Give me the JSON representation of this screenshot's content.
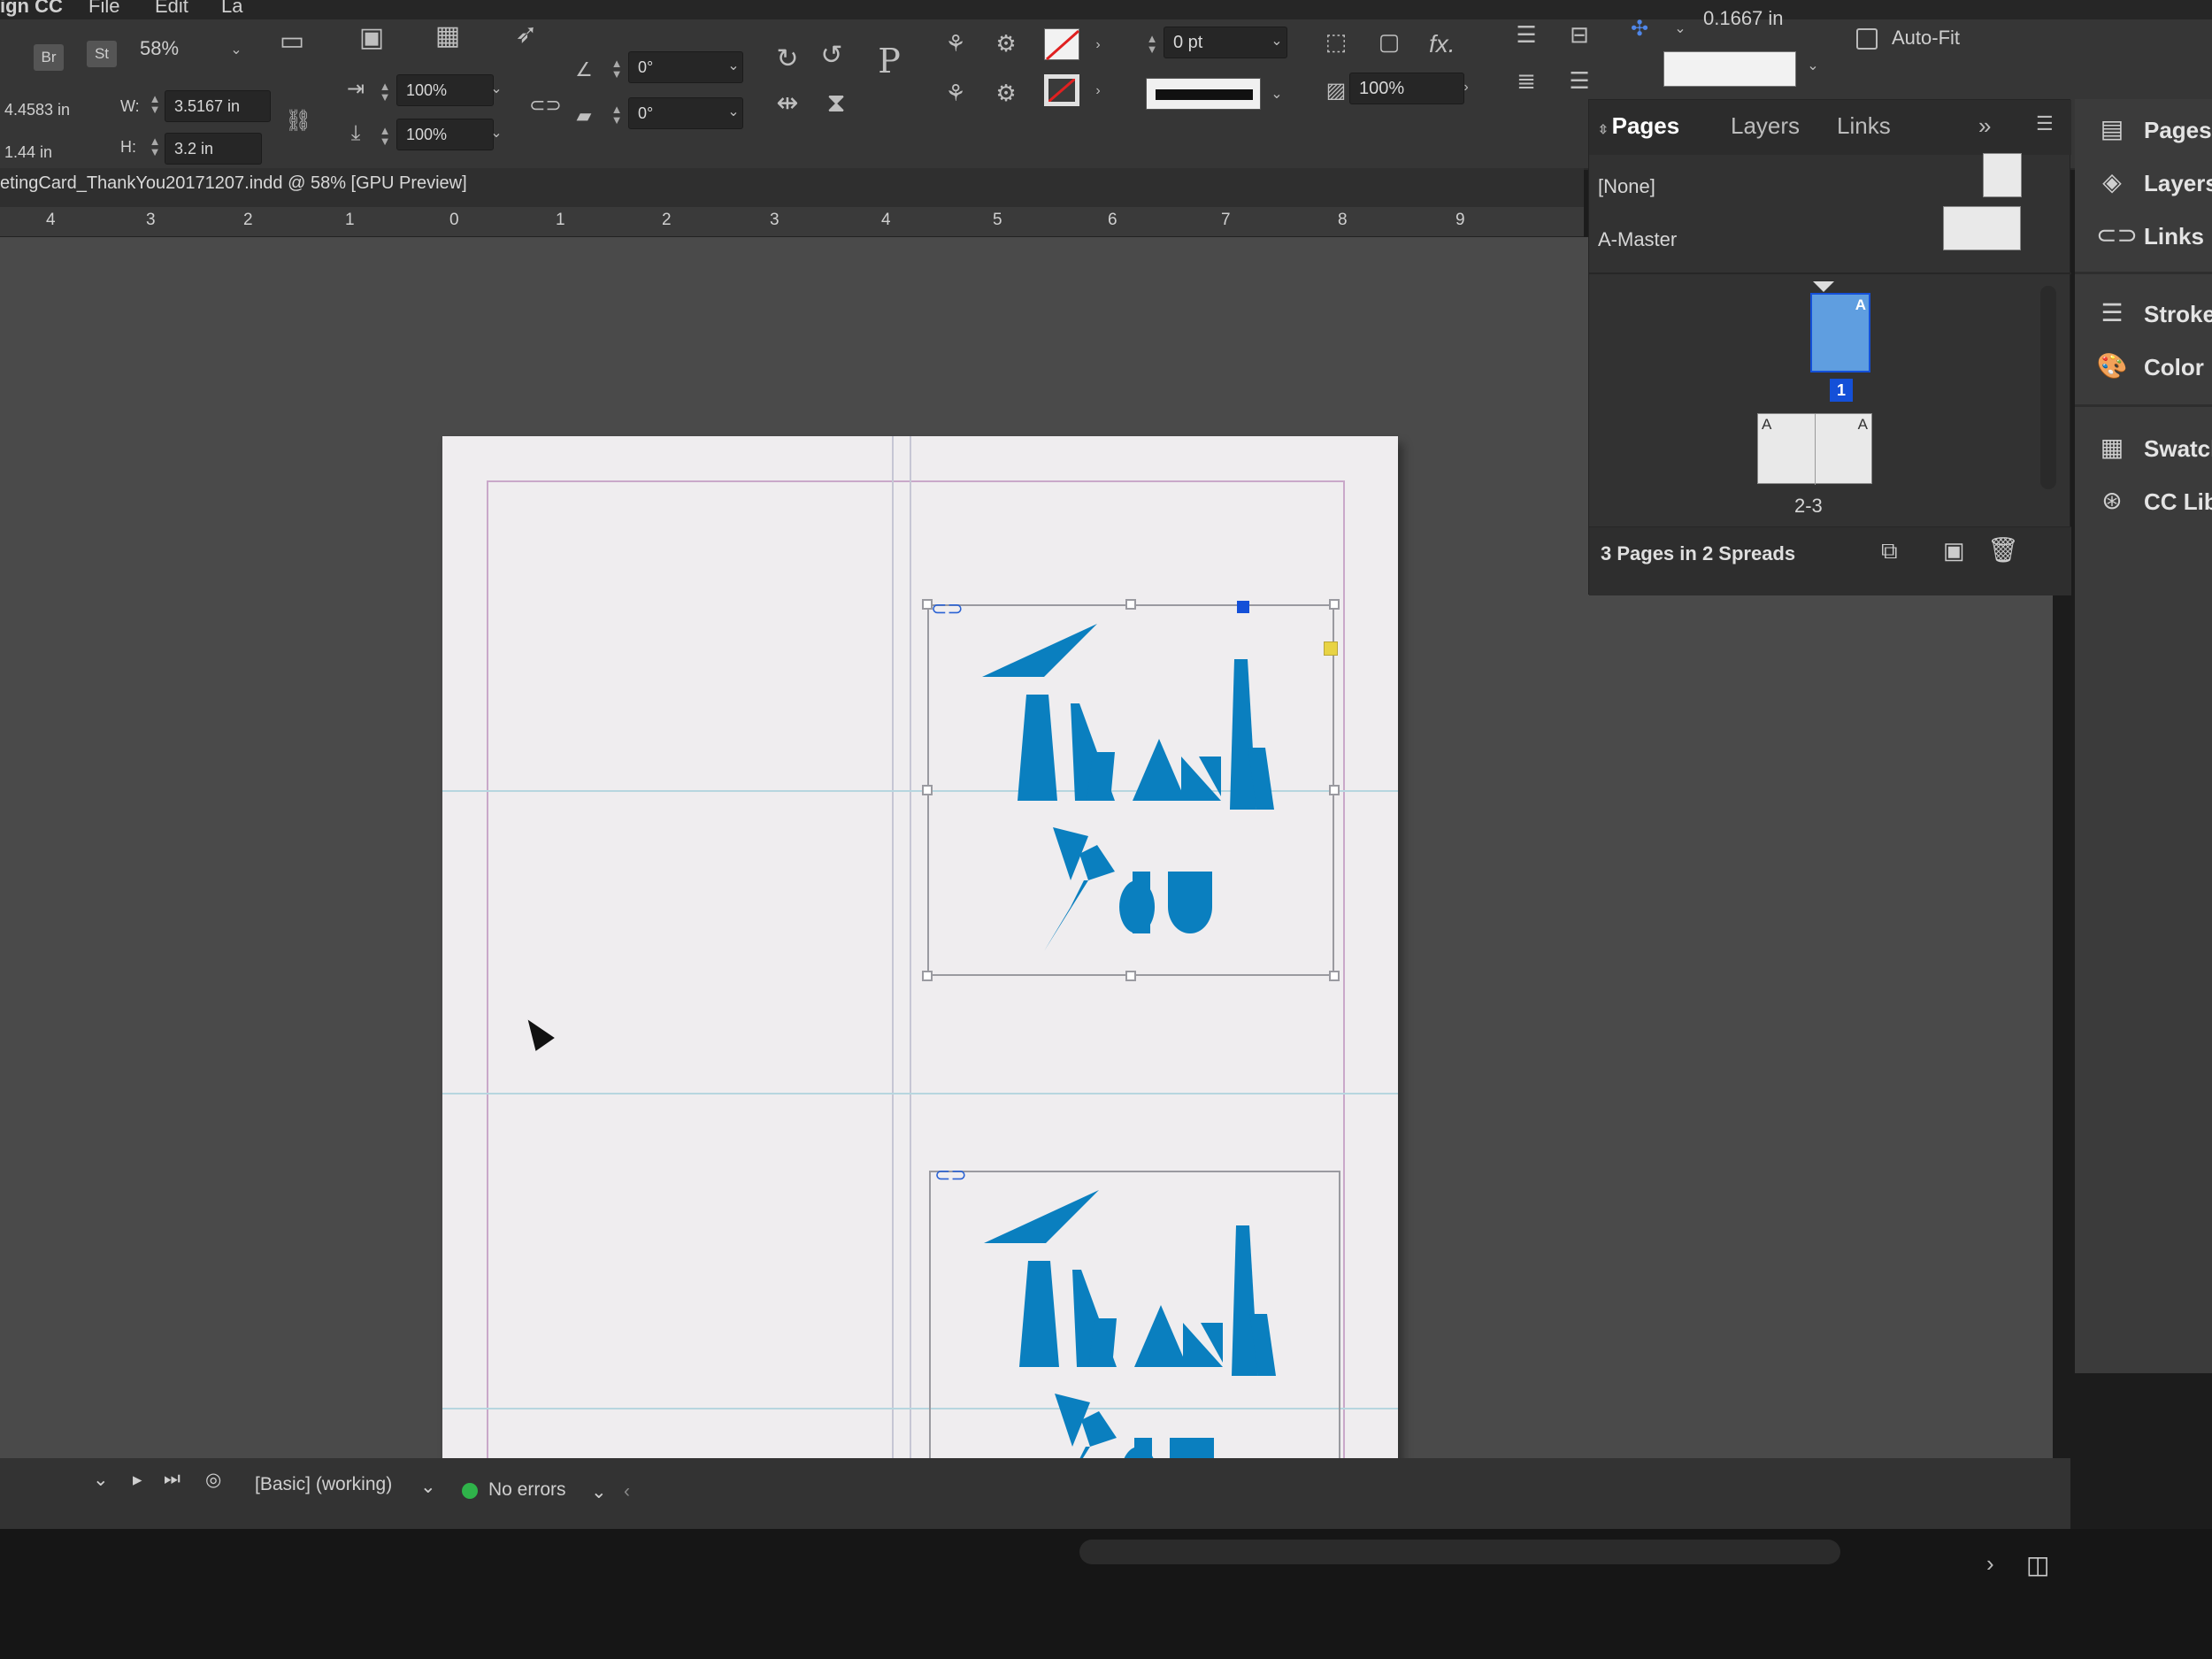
{
  "menubar": {
    "app": "ign CC",
    "file": "File",
    "edit": "Edit",
    "layout_fragment": "La"
  },
  "toolbar": {
    "bridge": "Br",
    "stock": "St",
    "zoom": "58%",
    "x": "4.4583 in",
    "y": "1.44 in",
    "w_label": "W:",
    "w_value": "3.5167 in",
    "h_label": "H:",
    "h_value": "3.2 in",
    "scale_x": "100%",
    "scale_y": "100%",
    "rotate": "0°",
    "shear": "0°",
    "stroke_weight": "0 pt",
    "opacity": "100%",
    "offset": "0.1667 in",
    "auto_fit": "Auto-Fit",
    "fx": "fx.",
    "type_icon": "P"
  },
  "document": {
    "tab_title": "etingCard_ThankYou20171207.indd @ 58% [GPU Preview]"
  },
  "ruler": {
    "left_ticks": [
      "4",
      "3",
      "2",
      "1",
      "0"
    ],
    "right_ticks": [
      "1",
      "2",
      "3",
      "4",
      "5",
      "6",
      "7",
      "8",
      "9"
    ]
  },
  "pages_panel": {
    "tabs": [
      "Pages",
      "Layers",
      "Links"
    ],
    "active_tab": "Pages",
    "none_label": "[None]",
    "master_label": "A-Master",
    "page1_number": "1",
    "page1_prefix": "A",
    "spread2_label": "2-3",
    "spread2_prefix_left": "A",
    "spread2_prefix_right": "A",
    "summary": "3 Pages in 2 Spreads"
  },
  "dock": {
    "items": [
      {
        "label": "Pages",
        "icon": "pages-icon"
      },
      {
        "label": "Layers",
        "icon": "layers-icon"
      },
      {
        "label": "Links",
        "icon": "links-icon"
      },
      {
        "label": "Stroke",
        "icon": "stroke-icon"
      },
      {
        "label": "Color",
        "icon": "color-icon"
      },
      {
        "label": "Swatches",
        "icon": "swatches-icon"
      },
      {
        "label": "CC Libraries",
        "icon": "cc-libraries-icon"
      }
    ]
  },
  "statusbar": {
    "preflight_profile": "[Basic] (working)",
    "errors": "No errors"
  },
  "colors": {
    "artwork_blue": "#0a7fbf",
    "selection_blue": "#1450d8",
    "preflight_ok": "#2fb34a"
  }
}
